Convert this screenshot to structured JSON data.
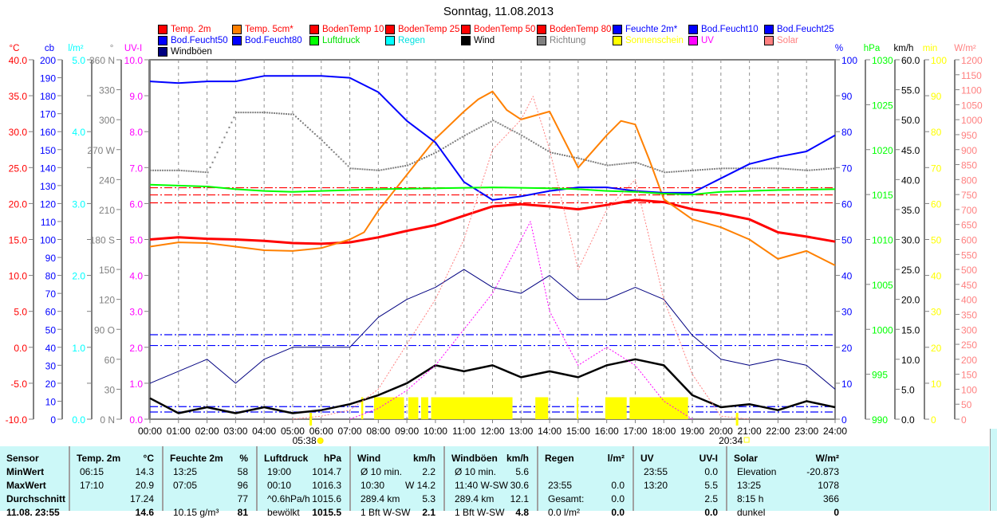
{
  "title": "Sonntag, 11.08.2013",
  "legend": [
    {
      "label": "Temp. 2m",
      "color": "#ff0000",
      "text_color": "#ff0000"
    },
    {
      "label": "Temp. 5cm*",
      "color": "#ff8000",
      "text_color": "#ff0000"
    },
    {
      "label": "BodenTemp 10",
      "color": "#ff0000",
      "text_color": "#ff0000"
    },
    {
      "label": "BodenTemp 25",
      "color": "#ff0000",
      "text_color": "#ff0000"
    },
    {
      "label": "BodenTemp 50",
      "color": "#ff0000",
      "text_color": "#ff0000"
    },
    {
      "label": "BodenTemp 80",
      "color": "#ff0000",
      "text_color": "#ff0000"
    },
    {
      "label": "Feuchte 2m*",
      "color": "#0000ff",
      "text_color": "#0000ff"
    },
    {
      "label": "Bod.Feucht10",
      "color": "#0000ff",
      "text_color": "#0000ff"
    },
    {
      "label": "Bod.Feucht25",
      "color": "#0000ff",
      "text_color": "#0000ff"
    },
    {
      "label": "Bod.Feucht50",
      "color": "#0000ff",
      "text_color": "#0000ff"
    },
    {
      "label": "Bod.Feucht80",
      "color": "#0000ff",
      "text_color": "#0000ff"
    },
    {
      "label": "Luftdruck",
      "color": "#00ff00",
      "text_color": "#00e000"
    },
    {
      "label": "Regen",
      "color": "#00ffff",
      "text_color": "#00e0e0"
    },
    {
      "label": "Wind",
      "color": "#000000",
      "text_color": "#000000"
    },
    {
      "label": "Richtung",
      "color": "#808080",
      "text_color": "#808080"
    },
    {
      "label": "Sonnenschein",
      "color": "#ffff00",
      "text_color": "#ffff00"
    },
    {
      "label": "UV",
      "color": "#ff00ff",
      "text_color": "#ff00ff"
    },
    {
      "label": "Solar",
      "color": "#ff8080",
      "text_color": "#ff8080"
    },
    {
      "label": "Windböen",
      "color": "#000080",
      "text_color": "#000000"
    }
  ],
  "chart_data": {
    "type": "line",
    "title": "Sonntag, 11.08.2013",
    "x_ticks": [
      "00:00",
      "01:00",
      "02:00",
      "03:00",
      "04:00",
      "05:00",
      "06:00",
      "07:00",
      "08:00",
      "09:00",
      "10:00",
      "11:00",
      "12:00",
      "13:00",
      "14:00",
      "15:00",
      "16:00",
      "17:00",
      "18:00",
      "19:00",
      "20:00",
      "21:00",
      "22:00",
      "23:00",
      "24:00"
    ],
    "sunrise": "05:38",
    "sunset": "20:34",
    "axes": [
      {
        "id": "temp",
        "title": "°C",
        "color": "#ff0000",
        "min": -10,
        "max": 40,
        "ticks": [
          "40.0",
          "35.0",
          "30.0",
          "25.0",
          "20.0",
          "15.0",
          "10.0",
          "5.0",
          "0.0",
          "-5.0",
          "-10.0"
        ]
      },
      {
        "id": "cb",
        "title": "cb",
        "color": "#0000ff",
        "min": 0,
        "max": 200,
        "ticks": [
          "200",
          "190",
          "180",
          "170",
          "160",
          "150",
          "140",
          "130",
          "120",
          "110",
          "100",
          "90",
          "80",
          "70",
          "60",
          "50",
          "40",
          "30",
          "20",
          "10",
          "0"
        ]
      },
      {
        "id": "rain",
        "title": "l/m²",
        "color": "#00ffff",
        "min": 0,
        "max": 5,
        "ticks": [
          "5.0",
          "",
          "4.0",
          "",
          "3.0",
          "",
          "2.0",
          "",
          "1.0",
          "",
          "0.0"
        ]
      },
      {
        "id": "dir",
        "title": "°",
        "color": "#808080",
        "min": 0,
        "max": 360,
        "ticks": [
          "360 N",
          "330",
          "300",
          "270 W",
          "240",
          "210",
          "180 S",
          "150",
          "120",
          "90  O",
          "60",
          "30",
          "0  N"
        ]
      },
      {
        "id": "uv",
        "title": "UV-I",
        "color": "#ff00ff",
        "min": 0,
        "max": 10,
        "ticks": [
          "10.0",
          "9.0",
          "8.0",
          "7.0",
          "6.0",
          "5.0",
          "4.0",
          "3.0",
          "2.0",
          "1.0",
          "0.0"
        ]
      },
      {
        "id": "hum",
        "title": "%",
        "color": "#0000ff",
        "min": 0,
        "max": 100,
        "ticks": [
          "100",
          "90",
          "80",
          "70",
          "60",
          "50",
          "40",
          "30",
          "20",
          "10",
          "0"
        ]
      },
      {
        "id": "press",
        "title": "hPa",
        "color": "#00ff00",
        "min": 990,
        "max": 1030,
        "ticks": [
          "1030",
          "1025",
          "1020",
          "1015",
          "1010",
          "1005",
          "1000",
          "995",
          "990"
        ]
      },
      {
        "id": "wind",
        "title": "km/h",
        "color": "#000000",
        "min": 0,
        "max": 60,
        "ticks": [
          "60.0",
          "55.0",
          "50.0",
          "45.0",
          "40.0",
          "35.0",
          "30.0",
          "25.0",
          "20.0",
          "15.0",
          "10.0",
          "5.0",
          "0.0"
        ]
      },
      {
        "id": "sun",
        "title": "min",
        "color": "#ffff00",
        "min": 0,
        "max": 100,
        "ticks": [
          "100",
          "90",
          "80",
          "70",
          "60",
          "50",
          "40",
          "30",
          "20",
          "10",
          "0"
        ]
      },
      {
        "id": "solar",
        "title": "W/m²",
        "color": "#ff8080",
        "min": 0,
        "max": 1200,
        "ticks": [
          "1200",
          "1150",
          "1100",
          "1050",
          "1000",
          "950",
          "900",
          "850",
          "800",
          "750",
          "700",
          "650",
          "600",
          "550",
          "500",
          "450",
          "400",
          "350",
          "300",
          "250",
          "200",
          "150",
          "100",
          "50",
          "0"
        ]
      }
    ],
    "series": [
      {
        "name": "Temp. 2m",
        "axis": "temp",
        "color": "#ff0000",
        "width": 3,
        "x_hours": [
          0,
          1,
          2,
          3,
          4,
          5,
          6,
          7,
          8,
          9,
          10,
          11,
          12,
          13,
          14,
          15,
          16,
          17,
          18,
          19,
          20,
          21,
          22,
          23,
          24
        ],
        "values": [
          15.0,
          15.3,
          15.1,
          15.0,
          14.8,
          14.5,
          14.4,
          14.6,
          15.3,
          16.2,
          17.0,
          18.3,
          19.6,
          19.9,
          19.6,
          19.2,
          19.8,
          20.5,
          20.2,
          19.2,
          18.6,
          17.8,
          16.0,
          15.4,
          14.7
        ]
      },
      {
        "name": "Temp. 5cm*",
        "axis": "temp",
        "color": "#ff8000",
        "width": 2,
        "x_hours": [
          0,
          1,
          2,
          3,
          4,
          5,
          6,
          7,
          7.5,
          8,
          9,
          10,
          11,
          11.5,
          12,
          12.5,
          13,
          14,
          15,
          16,
          16.5,
          17,
          17.5,
          18,
          19,
          20,
          21,
          22,
          23,
          24
        ],
        "values": [
          14.0,
          14.6,
          14.5,
          14.0,
          13.5,
          13.4,
          13.8,
          15.0,
          16.0,
          19.0,
          24.0,
          29.0,
          32.8,
          34.5,
          35.6,
          33.0,
          31.7,
          32.8,
          25.0,
          29.5,
          31.5,
          31.0,
          26.0,
          20.6,
          17.8,
          16.7,
          15.0,
          12.3,
          13.4,
          11.4
        ]
      },
      {
        "name": "Feuchte 2m*",
        "axis": "hum",
        "color": "#0000ff",
        "width": 2,
        "x_hours": [
          0,
          1,
          2,
          3,
          4,
          5,
          6,
          7,
          8,
          9,
          10,
          11,
          12,
          13,
          14,
          15,
          16,
          17,
          18,
          19,
          20,
          21,
          22,
          23,
          24
        ],
        "values": [
          94,
          93.5,
          94,
          94,
          95.5,
          95.5,
          95.5,
          95,
          91,
          83,
          77,
          66,
          61,
          62,
          63.5,
          64.5,
          64.5,
          63.5,
          63,
          63,
          67,
          71,
          73,
          74.5,
          79
        ]
      },
      {
        "name": "Luftdruck",
        "axis": "press",
        "color": "#00ff00",
        "width": 2,
        "x_hours": [
          0,
          1,
          2,
          3,
          4,
          5,
          6,
          7,
          8,
          10,
          12,
          14,
          15,
          16,
          17,
          18,
          19,
          20,
          22,
          24
        ],
        "values": [
          1016.1,
          1016.0,
          1015.9,
          1015.6,
          1015.4,
          1015.3,
          1015.4,
          1015.5,
          1015.6,
          1015.7,
          1015.8,
          1015.7,
          1015.6,
          1015.4,
          1015.3,
          1015.1,
          1015.0,
          1015.3,
          1015.5,
          1015.6
        ]
      },
      {
        "name": "Windböen",
        "axis": "wind",
        "color": "#000080",
        "width": 1,
        "x_hours": [
          0,
          1,
          2,
          3,
          4,
          5,
          6,
          7,
          8,
          9,
          10,
          11,
          12,
          13,
          14,
          15,
          16,
          17,
          18,
          19,
          20,
          21,
          22,
          23,
          24
        ],
        "values": [
          6,
          8,
          10,
          6,
          10,
          12,
          12,
          12,
          17,
          20,
          22,
          25,
          22,
          21,
          24,
          20,
          20,
          22,
          20,
          14,
          10,
          9,
          10,
          9,
          5
        ]
      },
      {
        "name": "Wind",
        "axis": "wind",
        "color": "#000000",
        "width": 2.5,
        "x_hours": [
          0,
          1,
          2,
          3,
          4,
          5,
          6,
          7,
          8,
          9,
          10,
          11,
          12,
          13,
          14,
          15,
          16,
          17,
          18,
          19,
          20,
          21,
          22,
          23,
          24
        ],
        "values": [
          3.5,
          1,
          2,
          1,
          2,
          1,
          1.5,
          2.5,
          4,
          6,
          9,
          8,
          9,
          7,
          8,
          7,
          9,
          10,
          9,
          4,
          2,
          2.5,
          1.5,
          3,
          2
        ]
      },
      {
        "name": "Solar",
        "axis": "solar",
        "color": "#ff8080",
        "width": 1,
        "dash": "2,2",
        "x_hours": [
          5,
          6,
          7,
          8,
          9,
          10,
          11,
          12,
          13,
          13.42,
          14,
          15,
          16,
          17,
          18,
          19,
          20,
          21
        ],
        "values": [
          0,
          10,
          30,
          100,
          250,
          400,
          600,
          900,
          1000,
          1078,
          900,
          500,
          700,
          800,
          400,
          150,
          10,
          0
        ]
      },
      {
        "name": "UV",
        "axis": "uv",
        "color": "#ff00ff",
        "width": 1,
        "dash": "2,2",
        "x_hours": [
          7,
          8,
          9,
          10,
          11,
          12,
          13,
          13.33,
          14,
          15,
          16,
          17,
          18,
          19
        ],
        "values": [
          0,
          0.3,
          0.8,
          1.5,
          2.5,
          3.5,
          5.0,
          5.5,
          3.0,
          1.5,
          2.0,
          1.5,
          0.5,
          0
        ]
      }
    ],
    "direction": {
      "name": "Richtung",
      "axis": "dir",
      "color": "#808080",
      "x_hours": [
        0,
        1,
        2,
        3,
        4,
        5,
        6,
        7,
        8,
        9,
        10,
        11,
        12,
        13,
        14,
        15,
        16,
        17,
        18,
        19,
        20,
        21,
        22,
        23,
        24
      ],
      "values": [
        250,
        250,
        248,
        308,
        308,
        306,
        280,
        252,
        250,
        255,
        268,
        285,
        300,
        285,
        268,
        262,
        255,
        258,
        248,
        250,
        252,
        252,
        252,
        250,
        252
      ]
    },
    "reference_lines": [
      {
        "name": "BodenTemp 10",
        "axis": "temp",
        "value": 22.2,
        "color": "#ff0000"
      },
      {
        "name": "BodenTemp 25",
        "axis": "temp",
        "value": 21.2,
        "color": "#ff0000"
      },
      {
        "name": "BodenTemp 50",
        "axis": "temp",
        "value": 20.1,
        "color": "#ff0000"
      },
      {
        "name": "Bod.Feucht10",
        "axis": "cb",
        "value": 47,
        "color": "#0000ff"
      },
      {
        "name": "Bod.Feucht25",
        "axis": "cb",
        "value": 41,
        "color": "#0000ff"
      },
      {
        "name": "Bod.Feucht50",
        "axis": "cb",
        "value": 7,
        "color": "#0000ff"
      },
      {
        "name": "Bod.Feucht80",
        "axis": "cb",
        "value": 4,
        "color": "#0000ff"
      }
    ],
    "sunshine_intervals": [
      [
        7.4,
        7.47
      ],
      [
        7.85,
        8.9
      ],
      [
        9.05,
        9.4
      ],
      [
        9.5,
        9.75
      ],
      [
        9.85,
        12.7
      ],
      [
        13.5,
        13.95
      ],
      [
        14.95,
        15.0
      ],
      [
        15.95,
        16.7
      ],
      [
        16.8,
        18.85
      ]
    ],
    "sunshine_minutes_level": 3
  },
  "table": {
    "columns": [
      {
        "title": "Sensor",
        "unit": "",
        "rows": [
          [
            "MinWert",
            ""
          ],
          [
            "MaxWert",
            ""
          ],
          [
            "Durchschnitt",
            ""
          ],
          [
            "11.08. 23:55",
            ""
          ]
        ]
      },
      {
        "title": "Temp. 2m",
        "unit": "°C",
        "rows": [
          [
            "06:15",
            "14.3"
          ],
          [
            "17:10",
            "20.9"
          ],
          [
            "",
            "17.24"
          ],
          [
            "",
            "14.6"
          ]
        ]
      },
      {
        "title": "Feuchte 2m",
        "unit": "%",
        "rows": [
          [
            "13:25",
            "58"
          ],
          [
            "07:05",
            "96"
          ],
          [
            "",
            "77"
          ],
          [
            "10.15 g/m³",
            "81"
          ]
        ]
      },
      {
        "title": "Luftdruck",
        "unit": "hPa",
        "rows": [
          [
            "19:00",
            "1014.7"
          ],
          [
            "00:10",
            "1016.3"
          ],
          [
            "^0.6hPa/h",
            "1015.6"
          ],
          [
            "bewölkt",
            "1015.5"
          ]
        ]
      },
      {
        "title": "Wind",
        "unit": "km/h",
        "rows": [
          [
            "Ø 10 min.",
            "2.2"
          ],
          [
            "10:30",
            "W 14.2"
          ],
          [
            "289.4 km",
            "5.3"
          ],
          [
            "1 Bft W-SW",
            "2.1"
          ]
        ]
      },
      {
        "title": "Windböen",
        "unit": "km/h",
        "rows": [
          [
            "Ø 10 min.",
            "5.6"
          ],
          [
            "11:40   W-SW",
            "30.6"
          ],
          [
            "289.4 km",
            "12.1"
          ],
          [
            "1 Bft W-SW",
            "4.8"
          ]
        ]
      },
      {
        "title": "Regen",
        "unit": "l/m²",
        "rows": [
          [
            "",
            ""
          ],
          [
            "23:55",
            "0.0"
          ],
          [
            "Gesamt:",
            "0.0"
          ],
          [
            "0.0 l/m²",
            "0.0"
          ]
        ]
      },
      {
        "title": "UV",
        "unit": "UV-I",
        "rows": [
          [
            "23:55",
            "0.0"
          ],
          [
            "13:20",
            "5.5"
          ],
          [
            "",
            "2.5"
          ],
          [
            "",
            "0.0"
          ]
        ]
      },
      {
        "title": "Solar",
        "unit": "W/m²",
        "rows": [
          [
            "Elevation",
            "-20.873"
          ],
          [
            "13:25",
            "1078"
          ],
          [
            "8:15 h",
            "366"
          ],
          [
            "dunkel",
            "0"
          ]
        ]
      }
    ]
  }
}
